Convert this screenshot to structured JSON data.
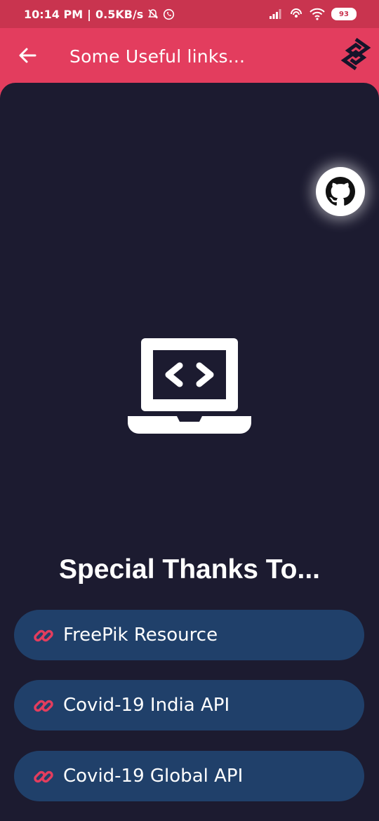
{
  "status_bar": {
    "time": "10:14 PM",
    "separator": "|",
    "speed": "0.5KB/s",
    "battery": "93"
  },
  "app_bar": {
    "title": "Some Useful links..."
  },
  "main": {
    "heading": "Special Thanks To...",
    "links": [
      {
        "label": "FreePik Resource"
      },
      {
        "label": "Covid-19 India API"
      },
      {
        "label": "Covid-19 Global API"
      }
    ]
  },
  "icons": {
    "back": "arrow-left-icon",
    "logo": "app-logo-icon",
    "github": "github-icon",
    "hero": "laptop-code-icon",
    "link": "link-icon"
  },
  "colors": {
    "accent": "#e33d5e",
    "status_bar": "#c9344f",
    "background": "#1c1b30",
    "link_button": "#20406a",
    "link_icon": "#e33d5e"
  }
}
